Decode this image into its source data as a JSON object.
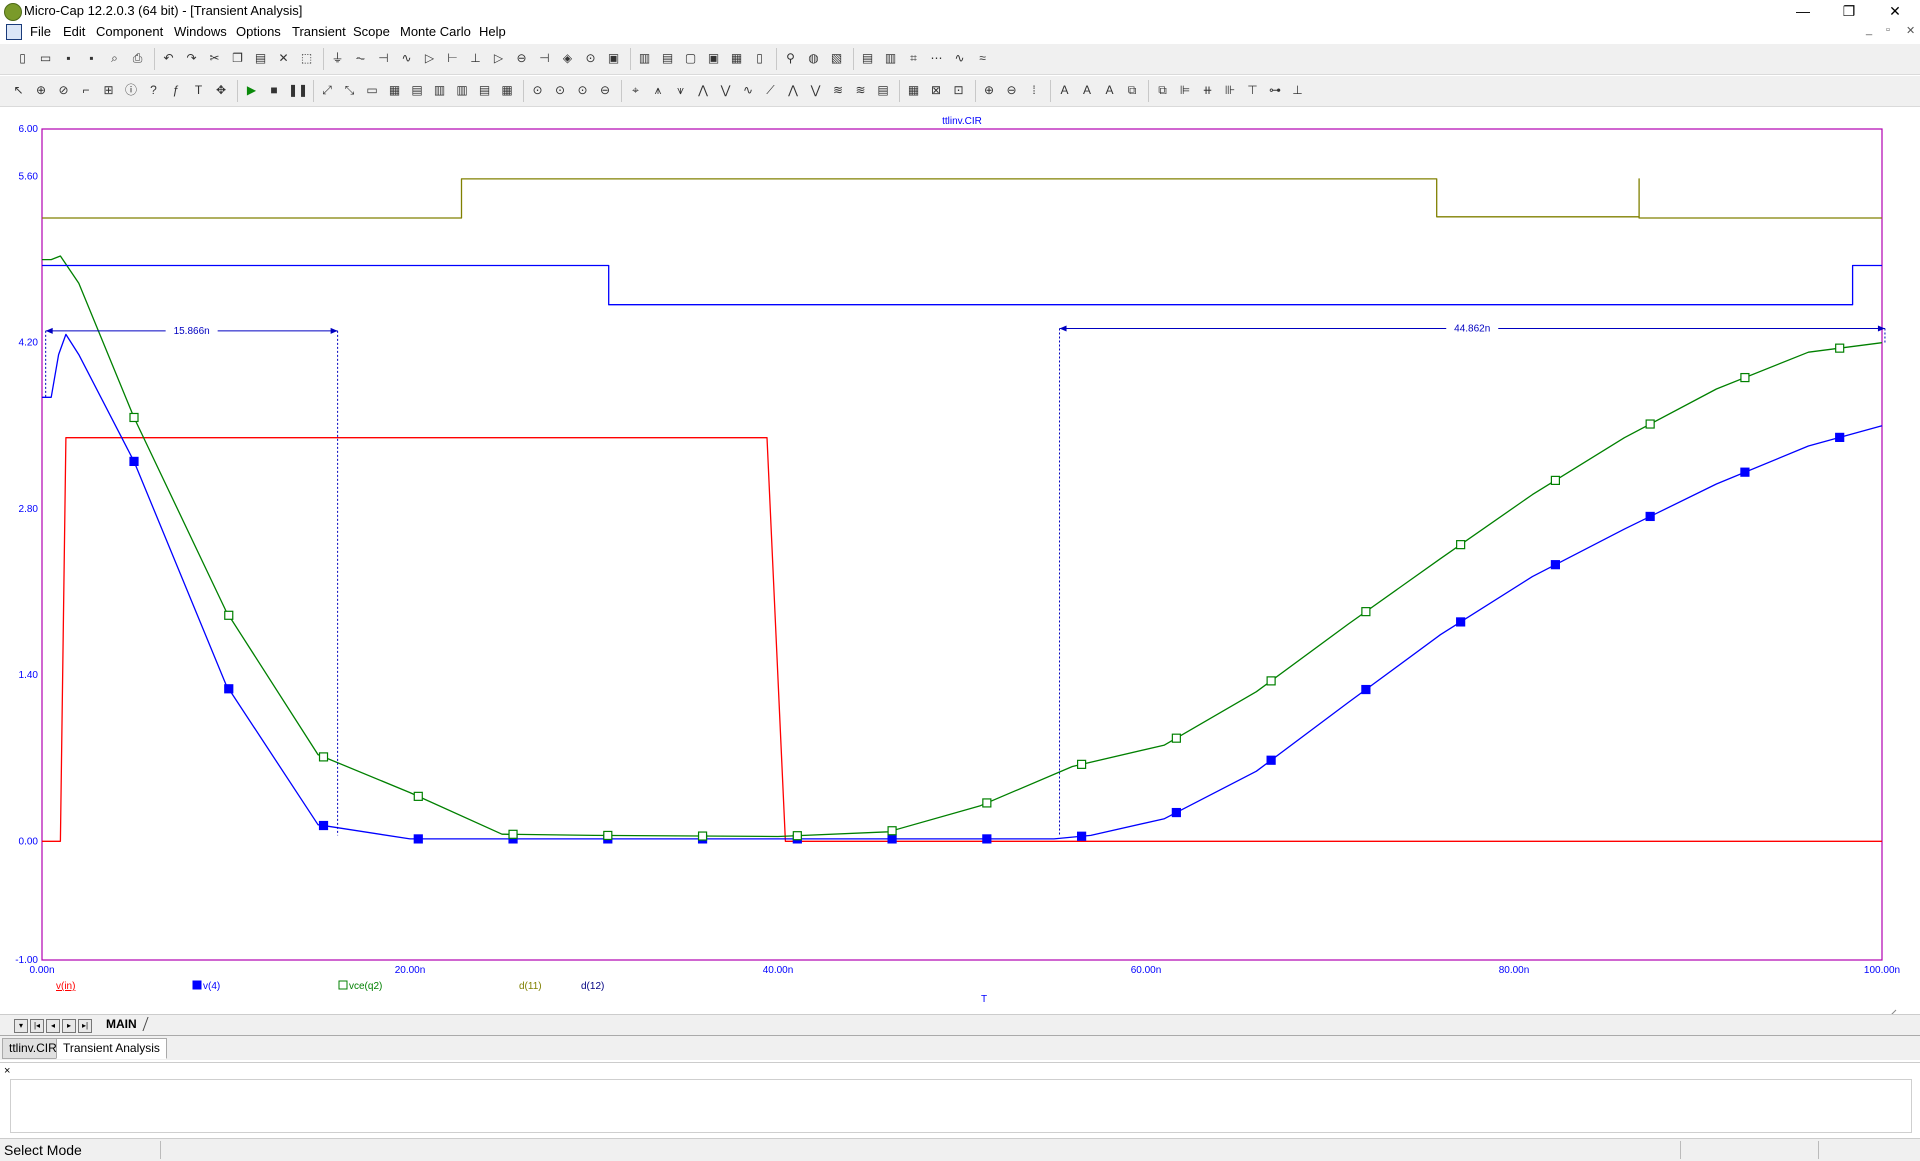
{
  "window": {
    "title": "Micro-Cap 12.2.0.3 (64 bit) - [Transient Analysis]",
    "minimize_glyph": "—",
    "maximize_glyph": "❐",
    "close_glyph": "✕"
  },
  "menu": [
    "File",
    "Edit",
    "Component",
    "Windows",
    "Options",
    "Transient",
    "Scope",
    "Monte Carlo",
    "Help"
  ],
  "mdi_controls": [
    "_",
    "▫",
    "✕"
  ],
  "toolbar1": {
    "icons": [
      "new-file-icon",
      "open-file-icon",
      "save-icon",
      "save-all-icon",
      "print-preview-icon",
      "print-icon",
      "undo-icon",
      "redo-icon",
      "cut-icon",
      "copy-icon",
      "paste-icon",
      "delete-icon",
      "select-all-icon",
      "ground-icon",
      "resistor-icon",
      "capacitor-icon",
      "inductor-icon",
      "diode-icon",
      "npn-icon",
      "nmos-icon",
      "opamp-icon",
      "source-icon",
      "battery-icon",
      "node-icon",
      "ac-source-icon",
      "cascade-icon",
      "tile-h-icon",
      "tile-v-icon",
      "window-icon",
      "window2-icon",
      "calculator-icon",
      "page-icon",
      "probe-icon",
      "globe-icon",
      "analysis-icon",
      "limits-icon",
      "step-icon",
      "numeric-icon",
      "stepping-icon",
      "plot-icon",
      "wave-icon"
    ]
  },
  "toolbar2": {
    "icons": [
      "select-mode-icon",
      "component-mode-icon",
      "text-mode-icon",
      "wire-mode-icon",
      "grid-icon",
      "info-icon",
      "help-icon",
      "func-icon",
      "text-icon",
      "pick-icon",
      "run-icon",
      "stop-icon",
      "pause-icon",
      "scale-icon",
      "auto-scale-icon",
      "toggle-a",
      "toggle-b",
      "toggle-c",
      "toggle-d",
      "toggle-e",
      "toggle-f",
      "toggle-g",
      "zoom-x-icon",
      "zoom-y-icon",
      "zoom-z-icon",
      "zoom-w-icon",
      "cursor-icon",
      "peak-icon",
      "valley-icon",
      "high-icon",
      "low-icon",
      "inflection-icon",
      "slope-icon",
      "global-high-icon",
      "global-low-icon",
      "top-icon",
      "bottom-icon",
      "properties-icon",
      "table-icon",
      "bounding-icon",
      "fit-icon",
      "zoom-in-icon",
      "zoom-out-icon",
      "pan-icon",
      "data-icon",
      "tag-icon",
      "text-tool-icon",
      "front-icon",
      "back-icon",
      "align-left-icon",
      "align-center-icon",
      "align-right-icon",
      "align-top-icon",
      "align-middle-icon",
      "align-bottom-icon"
    ]
  },
  "plot": {
    "file_title": "ttlinv.CIR",
    "x_axis_label": "T",
    "frame_color": "#b000b0",
    "axis_text_color": "#0000ff",
    "y_ticks": [
      "6.00",
      "5.60",
      "4.20",
      "2.80",
      "1.40",
      "0.00",
      "-1.00"
    ],
    "x_ticks": [
      "0.00n",
      "20.00n",
      "40.00n",
      "60.00n",
      "80.00n",
      "100.00n"
    ],
    "dimension_labels": [
      "15.866n",
      "44.862n"
    ],
    "legend": [
      {
        "label": "v(in)",
        "color": "#ff0000",
        "marker": "none"
      },
      {
        "label": "v(4)",
        "color": "#0000ff",
        "marker": "filled-square"
      },
      {
        "label": "vce(q2)",
        "color": "#008000",
        "marker": "open-square"
      },
      {
        "label": "d(11)",
        "color": "#808000",
        "marker": "none"
      },
      {
        "label": "d(12)",
        "color": "#000080",
        "marker": "none"
      }
    ]
  },
  "chart_data": {
    "type": "line",
    "title": "ttlinv.CIR",
    "xlabel": "T",
    "ylabel": "",
    "xlim": [
      0,
      100
    ],
    "ylim": [
      -1.0,
      6.0
    ],
    "x_unit": "n",
    "grid": false,
    "legend_position": "bottom-left",
    "series": [
      {
        "name": "v(in)",
        "color": "#ff0000",
        "points": [
          [
            0,
            0
          ],
          [
            1,
            0
          ],
          [
            1.3,
            3.4
          ],
          [
            39.4,
            3.4
          ],
          [
            40.4,
            0
          ],
          [
            100,
            0
          ]
        ]
      },
      {
        "name": "v(4)",
        "color": "#0000ff",
        "points": [
          [
            0,
            3.74
          ],
          [
            0.5,
            3.74
          ],
          [
            0.9,
            4.1
          ],
          [
            1.3,
            4.27
          ],
          [
            2,
            4.1
          ],
          [
            5,
            3.2
          ],
          [
            10,
            1.32
          ],
          [
            15,
            0.14
          ],
          [
            20,
            0.02
          ],
          [
            30,
            0.02
          ],
          [
            40,
            0.02
          ],
          [
            55,
            0.02
          ],
          [
            57,
            0.05
          ],
          [
            61,
            0.19
          ],
          [
            66,
            0.59
          ],
          [
            71,
            1.17
          ],
          [
            76,
            1.74
          ],
          [
            81,
            2.23
          ],
          [
            86,
            2.63
          ],
          [
            91,
            3.01
          ],
          [
            96,
            3.33
          ],
          [
            100,
            3.5
          ]
        ]
      },
      {
        "name": "vce(q2)",
        "color": "#008000",
        "points": [
          [
            0,
            4.9
          ],
          [
            0.5,
            4.9
          ],
          [
            1,
            4.93
          ],
          [
            2,
            4.7
          ],
          [
            5,
            3.57
          ],
          [
            10,
            1.94
          ],
          [
            15,
            0.73
          ],
          [
            20,
            0.41
          ],
          [
            25,
            0.06
          ],
          [
            30,
            0.05
          ],
          [
            40,
            0.04
          ],
          [
            46,
            0.08
          ],
          [
            51,
            0.3
          ],
          [
            56,
            0.63
          ],
          [
            61,
            0.81
          ],
          [
            66,
            1.26
          ],
          [
            71,
            1.83
          ],
          [
            76,
            2.38
          ],
          [
            81,
            2.92
          ],
          [
            86,
            3.4
          ],
          [
            91,
            3.81
          ],
          [
            96,
            4.12
          ],
          [
            100,
            4.2
          ]
        ]
      },
      {
        "name": "d(11)",
        "color": "#808000",
        "points": [
          [
            0,
            5.25
          ],
          [
            22.8,
            5.25
          ],
          [
            22.8,
            5.58
          ],
          [
            75.8,
            5.58
          ],
          [
            75.8,
            5.26
          ],
          [
            86.8,
            5.26
          ],
          [
            86.8,
            5.58
          ],
          [
            86.8,
            5.25
          ],
          [
            100,
            5.25
          ]
        ]
      },
      {
        "name": "d(12)",
        "color": "#0000ff",
        "points": [
          [
            0,
            4.85
          ],
          [
            30.8,
            4.85
          ],
          [
            30.8,
            4.52
          ],
          [
            98.4,
            4.52
          ],
          [
            98.4,
            4.85
          ],
          [
            100,
            4.85
          ]
        ]
      }
    ],
    "dimensions": [
      {
        "label": "15.866n",
        "x_start": 0.2,
        "x_end": 16.066
      },
      {
        "label": "44.862n",
        "x_start": 55.3,
        "x_end": 100.16
      }
    ]
  },
  "tabs": {
    "sheet_tab": "MAIN",
    "doc_tabs": [
      "ttlinv.CIR",
      "Transient Analysis"
    ]
  },
  "output_close": "×",
  "status": {
    "mode": "Select Mode"
  }
}
